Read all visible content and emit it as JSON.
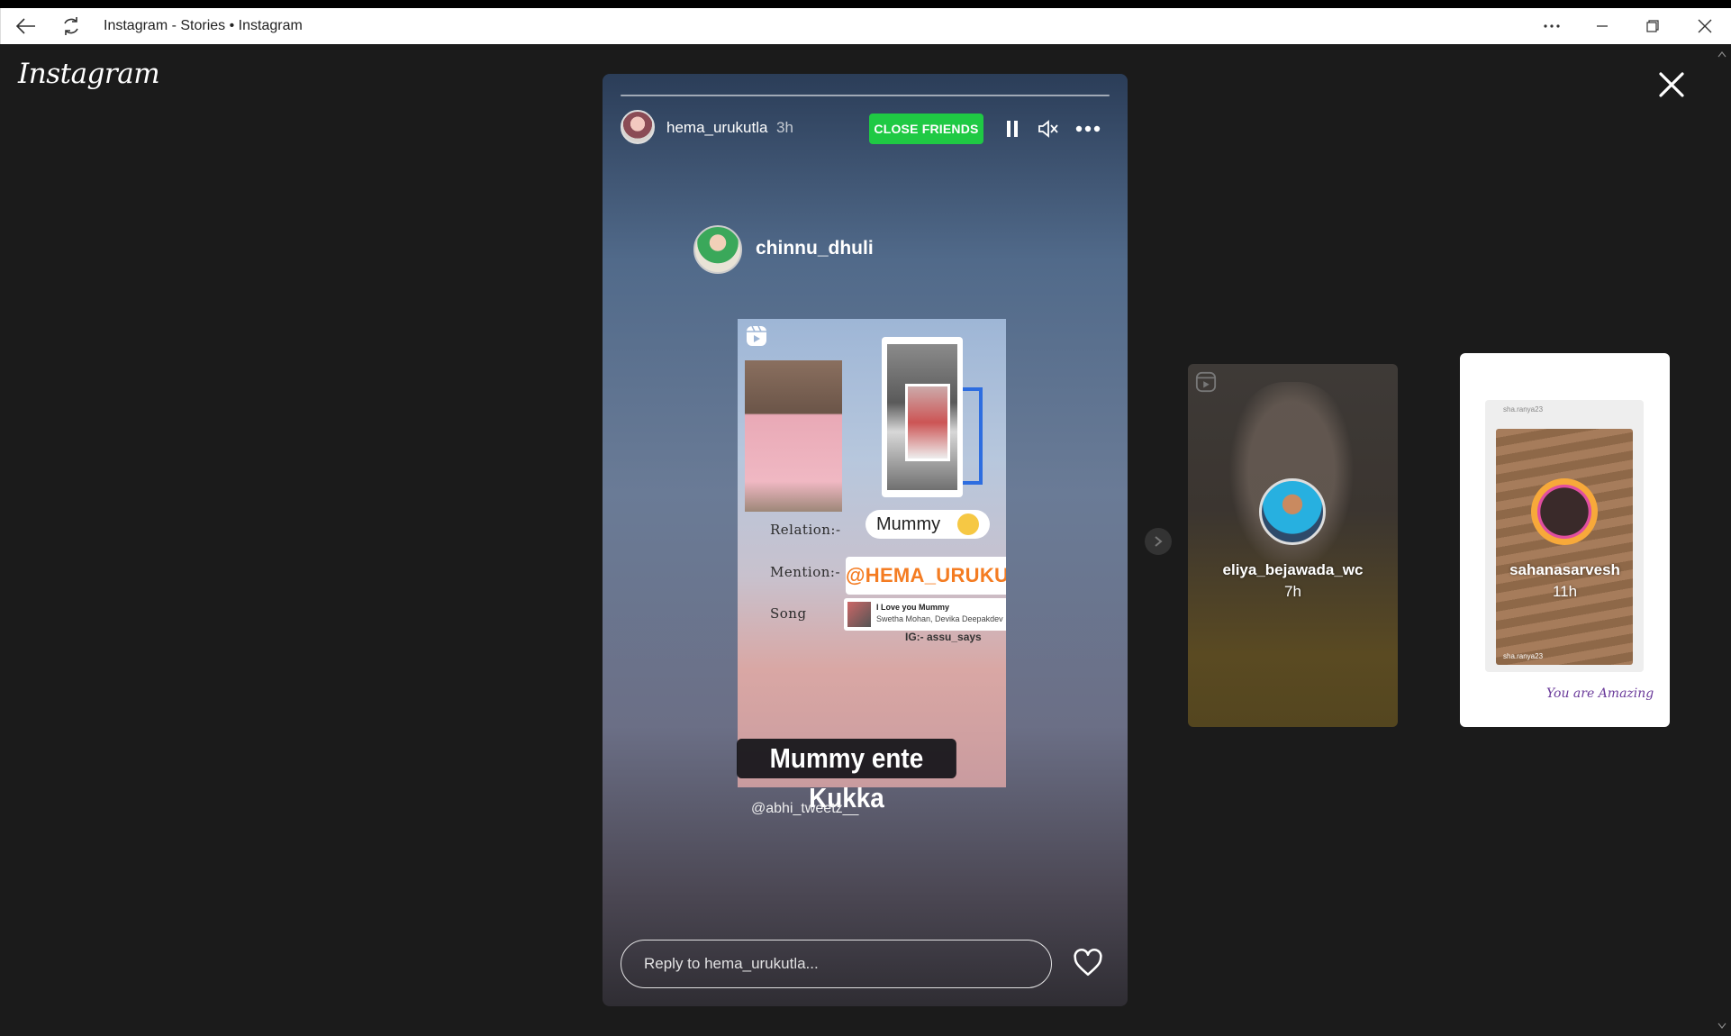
{
  "window": {
    "title": "Instagram - Stories • Instagram",
    "back_icon": "back-arrow-icon",
    "refresh_icon": "refresh-icon",
    "more_icon": "more-horizontal-icon",
    "minimize_icon": "minimize-icon",
    "restore_icon": "restore-icon",
    "close_icon": "close-icon"
  },
  "app": {
    "logo": "Instagram",
    "close_icon": "close-icon"
  },
  "story": {
    "progress": 0.0,
    "username": "hema_urukutla",
    "time": "3h",
    "badge": "CLOSE FRIENDS",
    "badge_color": "#1fc944",
    "pause_icon": "pause-icon",
    "mute_icon": "muted-speaker-icon",
    "options_icon": "more-horizontal-icon",
    "shared_post": {
      "author": "chinnu_dhuli",
      "relation_label": "Relation:-",
      "relation_value": "Mummy",
      "mention_label": "Mention:-",
      "mention_value": "@HEMA_URUKUTLA",
      "song_label": "Song",
      "song_title": "I Love you Mummy",
      "song_artist": "Swetha Mohan, Devika Deepakdev",
      "ig_credit": "IG:- assu_says",
      "caption": "Mummy ente Kukka",
      "credit": "@abhi_tweetz__"
    },
    "reply_placeholder": "Reply to hema_urukutla...",
    "like_icon": "heart-icon"
  },
  "next_stories": [
    {
      "username": "eliya_bejawada_wc",
      "time": "7h"
    },
    {
      "username": "sahanasarvesh",
      "time": "11h",
      "inner_tag": "sha.ranya23",
      "sticker": "You are Amazing"
    }
  ]
}
